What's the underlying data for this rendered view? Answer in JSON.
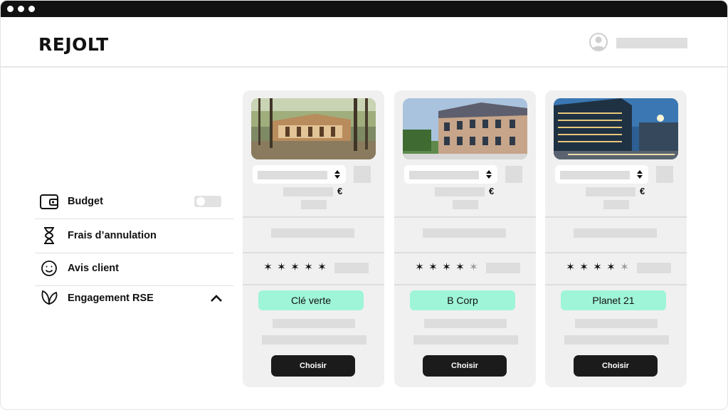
{
  "header": {
    "logo": "REJOLT"
  },
  "sidebar": {
    "filters": [
      {
        "label": "Budget",
        "icon": "wallet-icon",
        "control": "toggle"
      },
      {
        "label": "Frais d’annulation",
        "icon": "hourglass-icon"
      },
      {
        "label": "Avis client",
        "icon": "smiley-icon"
      },
      {
        "label": "Engagement RSE",
        "icon": "leaf-icon",
        "control": "chevron-up"
      }
    ]
  },
  "cards": [
    {
      "photo": "forest-wooden-lodge",
      "currency": "€",
      "stars_filled": 5,
      "stars_total": 5,
      "label": "Clé verte",
      "button": "Choisir"
    },
    {
      "photo": "historic-brick-chateau",
      "currency": "€",
      "stars_filled": 4,
      "stars_total": 5,
      "label": "B Corp",
      "button": "Choisir"
    },
    {
      "photo": "modern-glass-building-night",
      "currency": "€",
      "stars_filled": 4,
      "stars_total": 5,
      "label": "Planet 21",
      "button": "Choisir"
    }
  ],
  "colors": {
    "titlebar": "#111111",
    "card_background": "#f0f0f0",
    "label_badge": "#9ff5d8",
    "button": "#1b1b1b",
    "placeholder": "#dddddd"
  }
}
